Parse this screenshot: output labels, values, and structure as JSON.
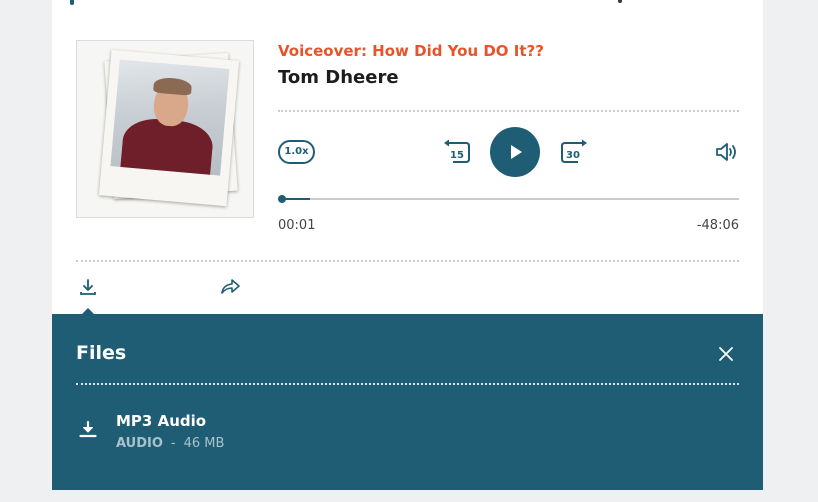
{
  "episode": {
    "title": "Voiceover: How Did You DO It??",
    "author": "Tom Dheere"
  },
  "controls": {
    "speed_label": "1.0x",
    "skip_back_seconds": "15",
    "skip_forward_seconds": "30",
    "progress_fraction": 0.01
  },
  "time": {
    "current": "00:01",
    "remaining": "-48:06"
  },
  "files_panel": {
    "heading": "Files",
    "items": [
      {
        "name": "MP3 Audio",
        "type": "AUDIO",
        "separator": "-",
        "size": "46 MB"
      }
    ]
  },
  "colors": {
    "accent": "#1f5d74",
    "title": "#e8542a"
  },
  "icons": [
    "speed-icon",
    "skip-back-icon",
    "play-icon",
    "skip-forward-icon",
    "volume-icon",
    "download-icon",
    "share-icon",
    "close-icon"
  ]
}
